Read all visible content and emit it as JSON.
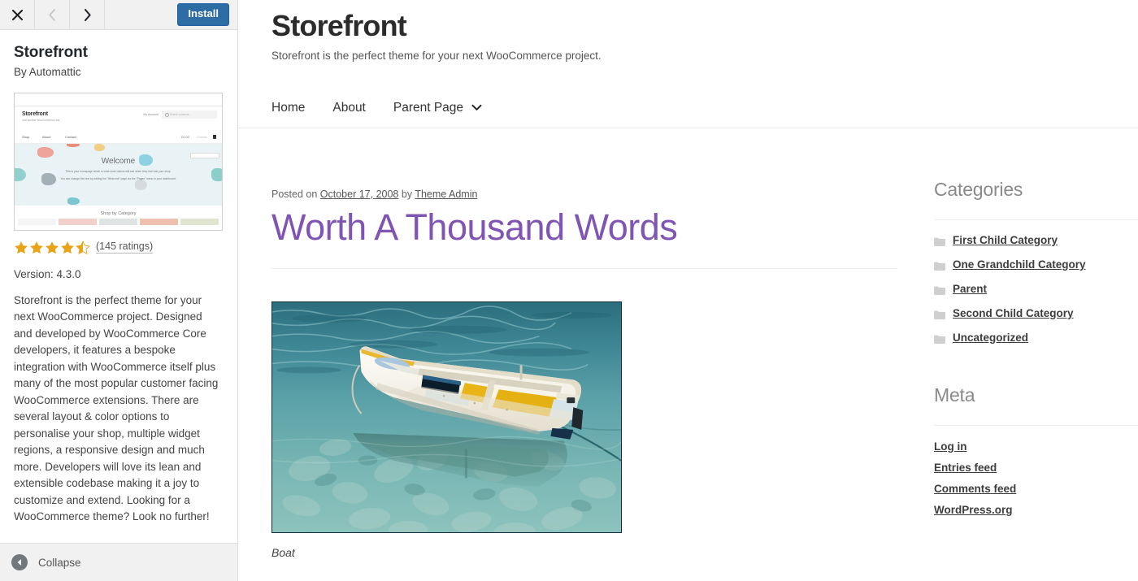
{
  "install_panel": {
    "toolbar": {
      "close_icon": "close-icon",
      "prev_icon": "chevron-left-icon",
      "next_icon": "chevron-right-icon",
      "install_label": "Install"
    },
    "theme_name": "Storefront",
    "author_line": "By Automattic",
    "screenshot": {
      "logo": "Storefront",
      "tagline": "Just another WooCommerce site",
      "my_account": "My Account",
      "search_placeholder": "Search products...",
      "nav": [
        "Shop",
        "About",
        "Contact"
      ],
      "cart_total": "£0.00",
      "cart_items": "0 items",
      "hero_title": "Welcome",
      "hero_line1": "This is your homepage which is what most visitors will see when they first visit your shop.",
      "hero_line2": "You can change this text by editing the \"Welcome\" page via the \"Pages\" menu in your dashboard.",
      "section_title": "Shop by Category"
    },
    "rating": {
      "stars_filled": 4,
      "half_star": true,
      "max_stars": 5,
      "count_label": "(145 ratings)",
      "star_color": "#e8a317"
    },
    "version_label": "Version: 4.3.0",
    "description": "Storefront is the perfect theme for your next WooCommerce project. Designed and developed by WooCommerce Core developers, it features a bespoke integration with WooCommerce itself plus many of the most popular customer facing WooCommerce extensions. There are several layout & color options to personalise your shop, multiple widget regions, a responsive design and much more. Developers will love its lean and extensible codebase making it a joy to customize and extend. Looking for a WooCommerce theme? Look no further!",
    "collapse": {
      "icon": "collapse-arrow-icon",
      "label": "Collapse"
    }
  },
  "preview": {
    "site_title": "Storefront",
    "site_description": "Storefront is the perfect theme for your next WooCommerce project.",
    "nav": [
      {
        "label": "Home",
        "has_caret": false
      },
      {
        "label": "About",
        "has_caret": false
      },
      {
        "label": "Parent Page",
        "has_caret": true
      }
    ],
    "post": {
      "posted_on_prefix": "Posted on",
      "date": "October 17, 2008",
      "by_prefix": "by",
      "author": "Theme Admin",
      "title": "Worth A Thousand Words",
      "title_color": "#7f54b3",
      "image_alt": "boat-photo",
      "caption": "Boat"
    },
    "widgets": [
      {
        "title": "Categories",
        "type": "category-list",
        "items": [
          "First Child Category",
          "One Grandchild Category",
          "Parent",
          "Second Child Category",
          "Uncategorized"
        ]
      },
      {
        "title": "Meta",
        "type": "meta-list",
        "items": [
          "Log in",
          "Entries feed",
          "Comments feed",
          "WordPress.org"
        ]
      }
    ]
  }
}
